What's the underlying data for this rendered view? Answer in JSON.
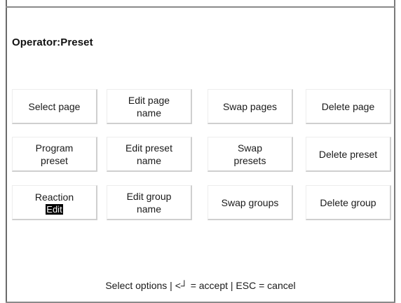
{
  "header": {
    "title": "Operator:Preset"
  },
  "buttons": {
    "select_page": "Select page",
    "edit_page_name": "Edit page\nname",
    "swap_pages": "Swap pages",
    "delete_page": "Delete page",
    "program_preset": "Program\npreset",
    "edit_preset_name": "Edit preset\nname",
    "swap_presets": "Swap\npresets",
    "delete_preset": "Delete preset",
    "reaction_label": "Reaction",
    "reaction_value": "Edit",
    "edit_group_name": "Edit group\nname",
    "swap_groups": "Swap groups",
    "delete_group": "Delete group"
  },
  "status_bar": {
    "text": "Select options | <┘ = accept | ESC = cancel"
  }
}
